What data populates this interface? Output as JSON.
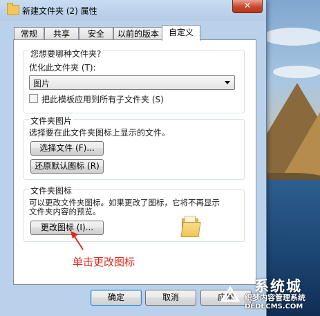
{
  "window": {
    "title": "新建文件夹 (2) 属性",
    "close_glyph": "✕"
  },
  "tabs": [
    {
      "label": "常规"
    },
    {
      "label": "共享"
    },
    {
      "label": "安全"
    },
    {
      "label": "以前的版本"
    },
    {
      "label": "自定义",
      "active": true
    }
  ],
  "optimize": {
    "heading": "您想要哪种文件夹?",
    "label": "优化此文件夹 (T):",
    "selected": "图片",
    "apply_subfolders_label": "把此模板应用到所有子文件夹 (S)",
    "apply_subfolders_checked": false
  },
  "folder_pictures": {
    "heading": "文件夹图片",
    "description": "选择要在此文件夹图标上显示的文件。",
    "choose_file_button": "选择文件 (F)...",
    "restore_default_button": "还原默认图标 (R)"
  },
  "folder_icons": {
    "heading": "文件夹图标",
    "description_line1": "可以更改文件夹图标。如果更改了图标，它将不再显示",
    "description_line2": "文件夹内容的预览。",
    "change_icon_button": "更改图标 (I)...",
    "preview_icon": "folder-icon"
  },
  "annotation": {
    "text": "单击更改图标",
    "color": "#e0281c"
  },
  "footer": {
    "ok": "确定",
    "cancel": "取消",
    "apply": "应用"
  },
  "watermark": {
    "big_text": "系统城",
    "line1": "织梦内容管理系统",
    "line2": "DEDECMS.COM"
  },
  "colors": {
    "accent": "#3c7fb1",
    "close_button": "#c9462c",
    "annotation": "#e0281c"
  }
}
